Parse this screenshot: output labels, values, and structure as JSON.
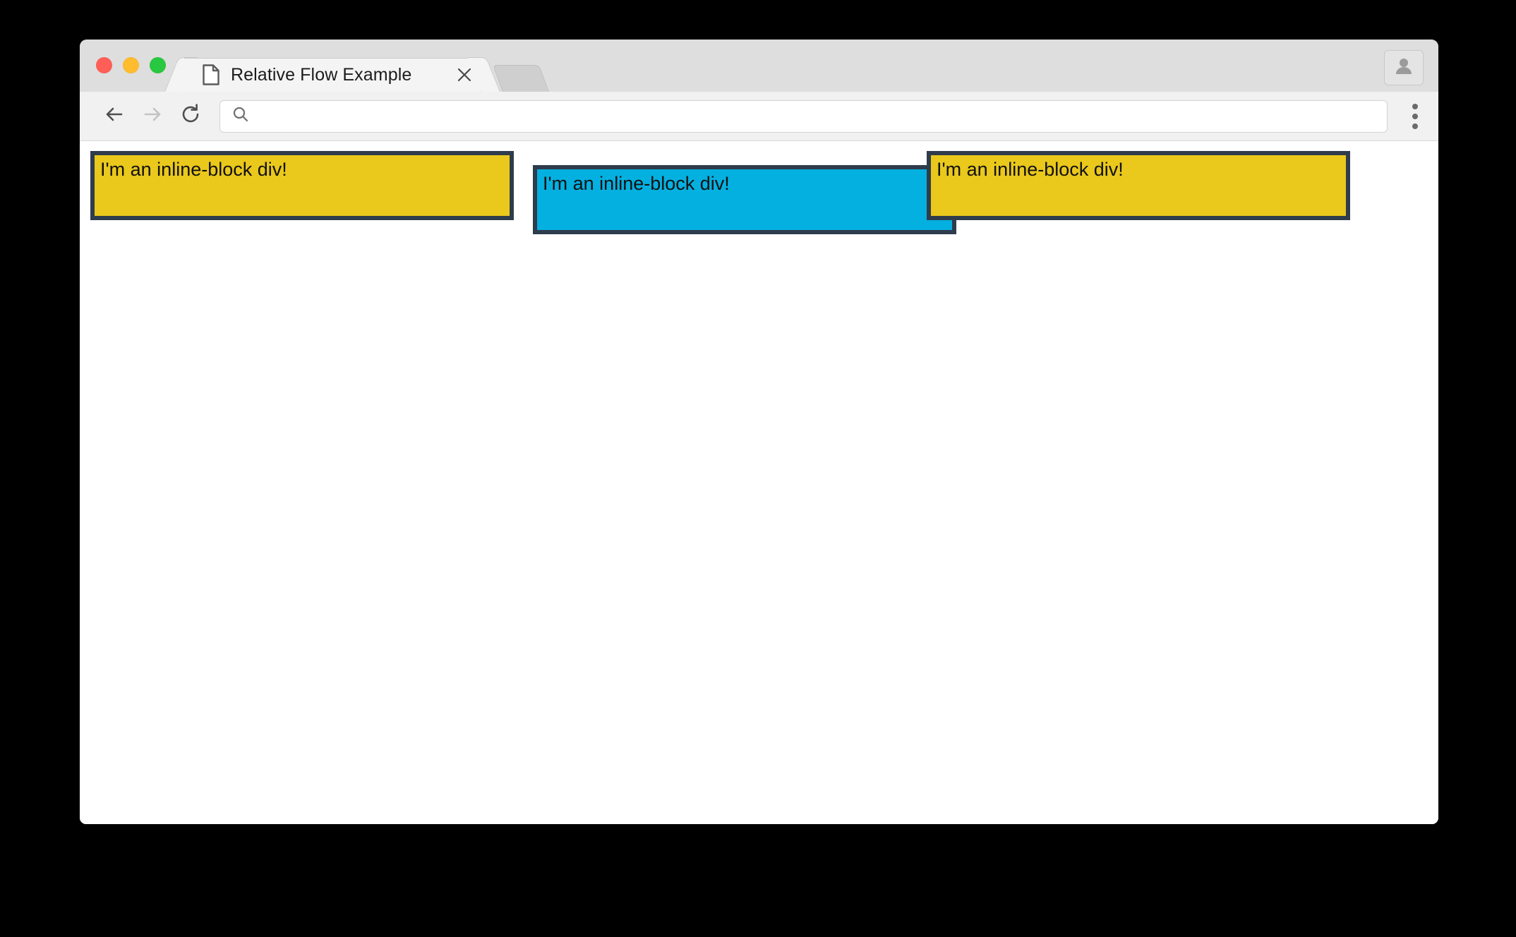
{
  "window": {
    "traffic_lights": [
      {
        "name": "close",
        "color": "#ff5f57"
      },
      {
        "name": "minimize",
        "color": "#febc2e"
      },
      {
        "name": "maximize",
        "color": "#28c840"
      }
    ]
  },
  "tabs": [
    {
      "title": "Relative Flow Example",
      "favicon": "page-icon",
      "close_label": "×",
      "active": true
    }
  ],
  "new_tab": {
    "label": ""
  },
  "profile": {
    "icon": "person-icon",
    "label": ""
  },
  "toolbar": {
    "back": {
      "icon": "arrow-left-icon",
      "enabled": true
    },
    "forward": {
      "icon": "arrow-right-icon",
      "enabled": false
    },
    "reload": {
      "icon": "reload-icon",
      "enabled": true
    },
    "omnibox": {
      "icon": "search-icon",
      "value": "",
      "placeholder": ""
    },
    "menu": {
      "icon": "three-dots-vertical-icon"
    }
  },
  "page": {
    "background": "#ffffff",
    "boxes": [
      {
        "text": "I'm an inline-block div!",
        "background": "#eac81c",
        "border_color": "#2f3c4c",
        "position": "static"
      },
      {
        "text": "I'm an inline-block div!",
        "background": "#04b0e0",
        "border_color": "#2f3c4c",
        "position": "relative"
      },
      {
        "text": "I'm an inline-block div!",
        "background": "#eac81c",
        "border_color": "#2f3c4c",
        "position": "static"
      }
    ]
  }
}
